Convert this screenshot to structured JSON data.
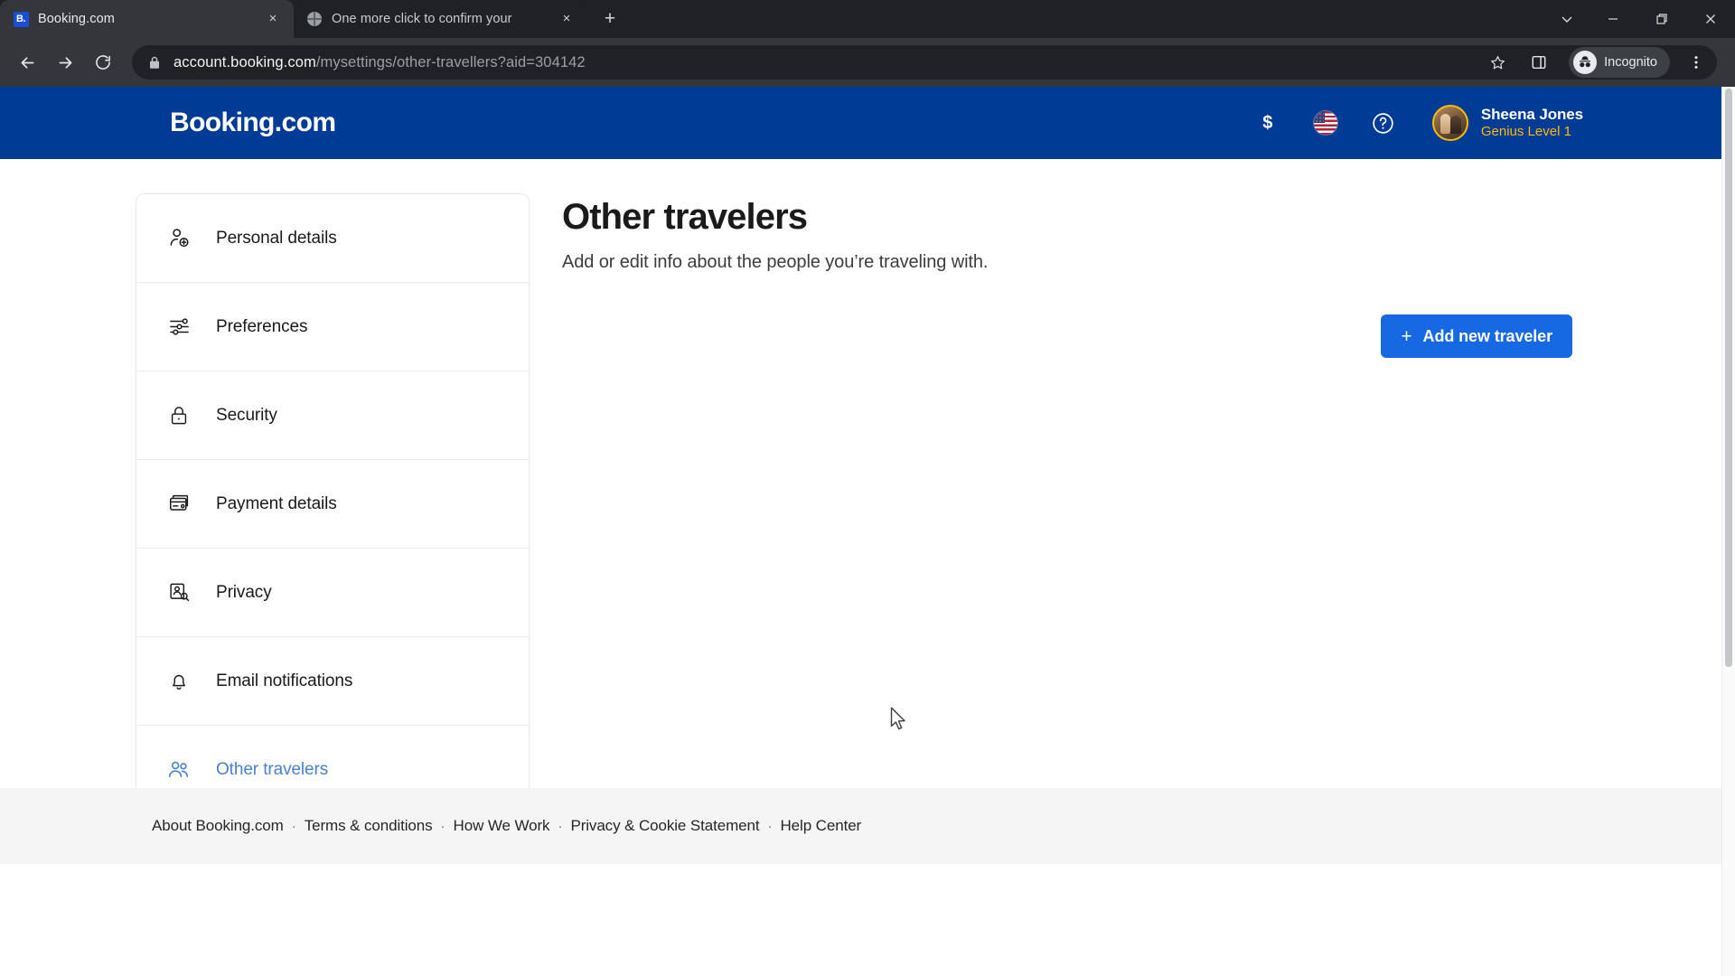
{
  "browser": {
    "tabs": [
      {
        "title": "Booking.com",
        "favicon": "booking-favicon",
        "active": true,
        "close_label": "×"
      },
      {
        "title": "One more click to confirm your ",
        "favicon": "globe-icon",
        "active": false,
        "close_label": "×"
      }
    ],
    "new_tab_label": "+",
    "window_controls": {
      "tab_search": "tab-search-chevron-down-icon",
      "minimize": "—",
      "maximize": "restore-icon",
      "close": "✕"
    },
    "toolbar": {
      "back": "back-arrow-icon",
      "forward": "forward-arrow-icon",
      "reload": "reload-icon",
      "lock": "lock-icon",
      "url_host": "account.booking.com",
      "url_path": "/mysettings/other-travellers?aid=304142",
      "bookmark": "star-icon",
      "side_panel": "side-panel-icon",
      "profile_label": "Incognito",
      "menu": "three-dot-menu-icon"
    }
  },
  "site_header": {
    "brand": "Booking.com",
    "currency_symbol": "$",
    "language_flag": "us-flag-icon",
    "help_label": "?",
    "user": {
      "name": "Sheena Jones",
      "level": "Genius Level 1"
    }
  },
  "sidebar": {
    "items": [
      {
        "label": "Personal details",
        "icon": "person-add-icon",
        "active": false
      },
      {
        "label": "Preferences",
        "icon": "sliders-icon",
        "active": false
      },
      {
        "label": "Security",
        "icon": "lock-icon",
        "active": false
      },
      {
        "label": "Payment details",
        "icon": "credit-card-icon",
        "active": false
      },
      {
        "label": "Privacy",
        "icon": "privacy-person-icon",
        "active": false
      },
      {
        "label": "Email notifications",
        "icon": "bell-icon",
        "active": false
      },
      {
        "label": "Other travelers",
        "icon": "people-icon",
        "active": true
      }
    ]
  },
  "main": {
    "title": "Other travelers",
    "subtitle": "Add or edit info about the people you’re traveling with.",
    "add_button_label": "Add new traveler",
    "add_button_icon": "plus-icon"
  },
  "footer": {
    "links": [
      "About Booking.com",
      "Terms & conditions",
      "How We Work",
      "Privacy & Cookie Statement",
      "Help Center"
    ],
    "separator": "·"
  },
  "colors": {
    "brand_blue": "#003b95",
    "accent_blue": "#1668e3",
    "genius_gold": "#febb02",
    "active_link": "#4a7fd4",
    "footer_bg": "#f5f5f5"
  }
}
